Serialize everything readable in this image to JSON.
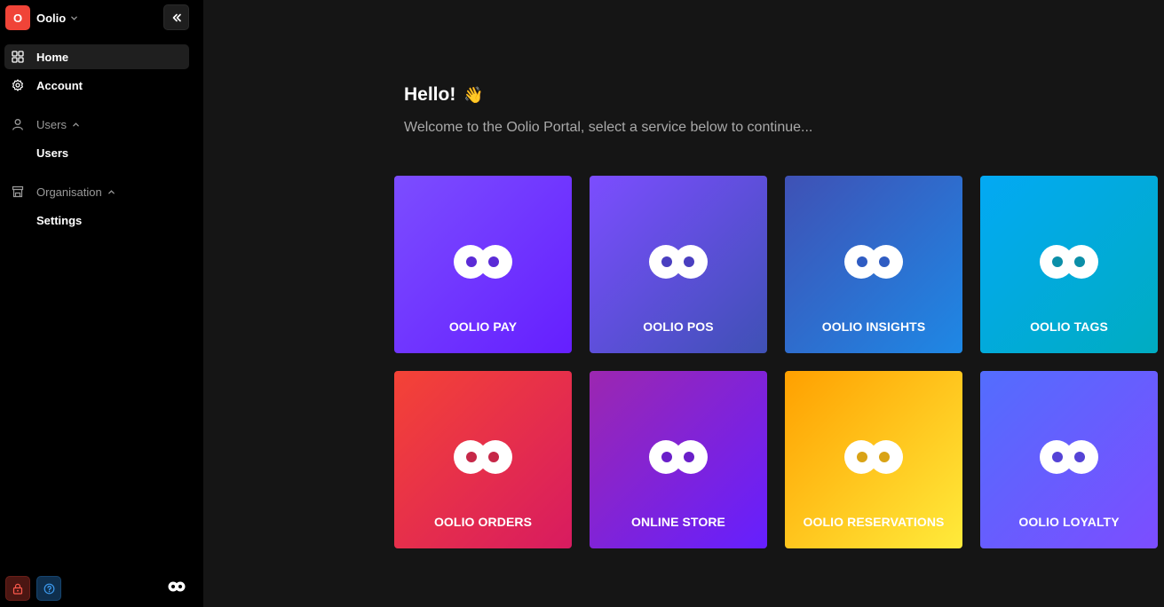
{
  "sidebar": {
    "org": {
      "initial": "O",
      "name": "Oolio"
    },
    "nav": [
      {
        "label": "Home",
        "icon": "grid-icon",
        "active": true
      },
      {
        "label": "Account",
        "icon": "gear-icon",
        "active": false
      }
    ],
    "groups": [
      {
        "label": "Users",
        "icon": "user-icon",
        "items": [
          {
            "label": "Users"
          }
        ]
      },
      {
        "label": "Organisation",
        "icon": "store-icon",
        "items": [
          {
            "label": "Settings"
          }
        ]
      }
    ],
    "footer": {
      "lock_icon": "lock-icon",
      "help_icon": "help-icon",
      "logo_icon": "oolio-logo-icon"
    }
  },
  "main": {
    "greeting": "Hello!",
    "greeting_emoji": "👋",
    "subtitle": "Welcome to the Oolio Portal, select a service below to continue...",
    "tiles": [
      {
        "label": "OOLIO PAY",
        "from": "#7c4dff",
        "to": "#651fff",
        "dot": "#5b2bd6"
      },
      {
        "label": "OOLIO POS",
        "from": "#7c4dff",
        "to": "#3f51b5",
        "dot": "#4a3fc0"
      },
      {
        "label": "OOLIO INSIGHTS",
        "from": "#3f51b5",
        "to": "#1e88e5",
        "dot": "#2f5cc2"
      },
      {
        "label": "OOLIO TAGS",
        "from": "#03a9f4",
        "to": "#00acc1",
        "dot": "#0b8fa8"
      },
      {
        "label": "OOLIO ORDERS",
        "from": "#f44336",
        "to": "#d81b60",
        "dot": "#c62848"
      },
      {
        "label": "ONLINE STORE",
        "from": "#9c27b0",
        "to": "#651fff",
        "dot": "#6a1fc9"
      },
      {
        "label": "OOLIO RESERVATIONS",
        "from": "#ffa000",
        "to": "#ffeb3b",
        "dot": "#d9a316"
      },
      {
        "label": "OOLIO LOYALTY",
        "from": "#536dfe",
        "to": "#7c4dff",
        "dot": "#5543d6"
      }
    ]
  }
}
